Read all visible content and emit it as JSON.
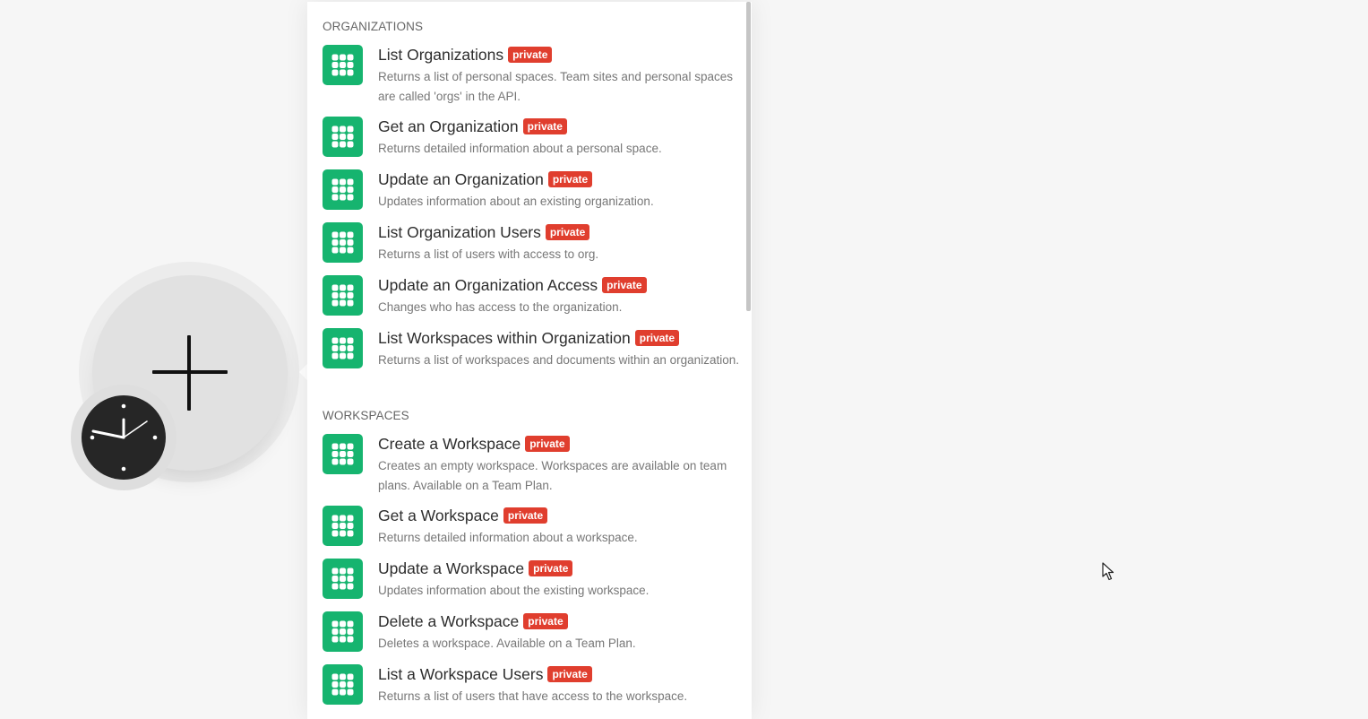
{
  "sections": [
    {
      "title": "ORGANIZATIONS",
      "items": [
        {
          "title": "List Organizations",
          "badge": "private",
          "description": "Returns a list of personal spaces. Team sites and personal spaces are called 'orgs' in the API."
        },
        {
          "title": "Get an Organization",
          "badge": "private",
          "description": "Returns detailed information about a personal space."
        },
        {
          "title": "Update an Organization",
          "badge": "private",
          "description": "Updates information about an existing organization."
        },
        {
          "title": "List Organization Users",
          "badge": "private",
          "description": "Returns a list of users with access to org."
        },
        {
          "title": "Update an Organization Access",
          "badge": "private",
          "description": "Changes who has access to the organization."
        },
        {
          "title": "List Workspaces within Organization",
          "badge": "private",
          "description": "Returns a list of workspaces and documents within an organization."
        }
      ]
    },
    {
      "title": "WORKSPACES",
      "items": [
        {
          "title": "Create a Workspace",
          "badge": "private",
          "description": "Creates an empty workspace. Workspaces are available on team plans. Available on a Team Plan."
        },
        {
          "title": "Get a Workspace",
          "badge": "private",
          "description": "Returns detailed information about a workspace."
        },
        {
          "title": "Update a Workspace",
          "badge": "private",
          "description": "Updates information about the existing workspace."
        },
        {
          "title": "Delete a Workspace",
          "badge": "private",
          "description": "Deletes a workspace. Available on a Team Plan."
        },
        {
          "title": "List a Workspace Users",
          "badge": "private",
          "description": "Returns a list of users that have access to the workspace."
        }
      ]
    }
  ],
  "icons": {
    "app_icon": "grist-grid-icon",
    "add_module": "plus-icon",
    "trigger": "clock-icon",
    "pointer": "cursor-icon"
  },
  "colors": {
    "app_icon_bg": "#16b46f",
    "badge_bg": "#e03e2e",
    "canvas_bg": "#f6f6f6"
  }
}
